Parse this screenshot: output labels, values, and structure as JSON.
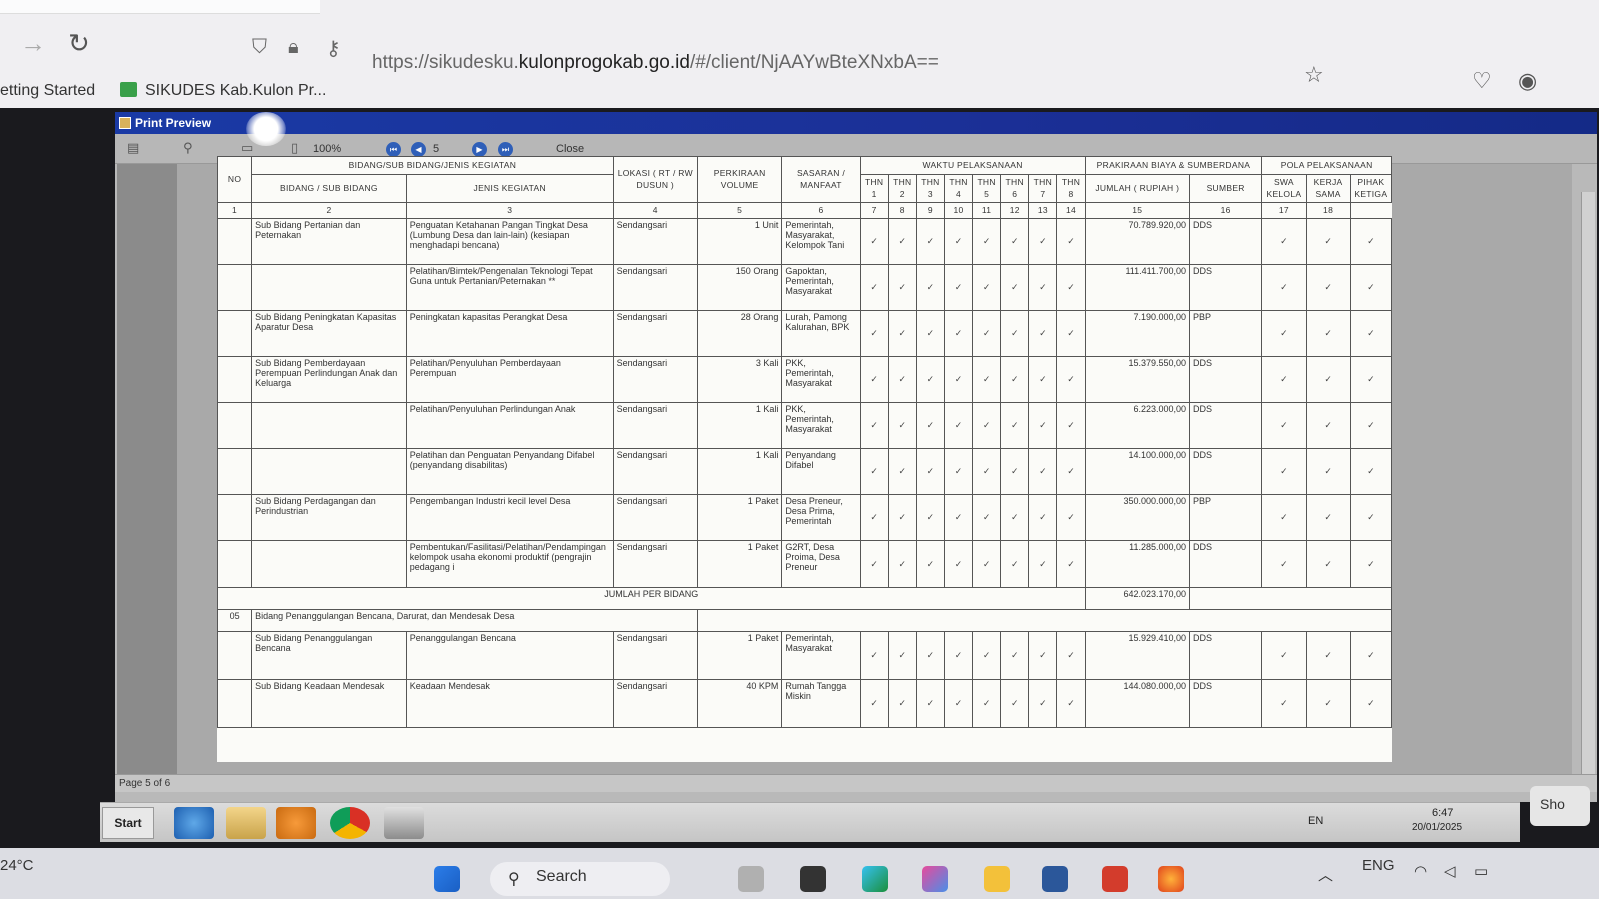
{
  "browser": {
    "url_prefix": "https://sikudesku.",
    "url_domain": "kulonprogokab.go.id",
    "url_suffix": "/#/client/NjAAYwBteXNxbA==",
    "bookmarks": [
      "etting Started",
      "SIKUDES Kab.Kulon Pr..."
    ]
  },
  "print_preview": {
    "title": "Print Preview",
    "zoom": "100%",
    "page_number": "5",
    "close_label": "Close",
    "status": "Page 5 of 6"
  },
  "table": {
    "header": {
      "no": "NO",
      "bidang_group": "BIDANG/SUB BIDANG/JENIS KEGIATAN",
      "bidang_sub": "BIDANG / SUB BIDANG",
      "jenis": "JENIS KEGIATAN",
      "lokasi": "LOKASI ( RT / RW DUSUN )",
      "volume": "PERKIRAAN VOLUME",
      "sasaran": "SASARAN / MANFAAT",
      "waktu": "WAKTU PELAKSANAAN",
      "thn": [
        "THN 1",
        "THN 2",
        "THN 3",
        "THN 4",
        "THN 5",
        "THN 6",
        "THN 7",
        "THN 8"
      ],
      "biaya_group": "PRAKIRAAN BIAYA & SUMBERDANA",
      "jumlah": "JUMLAH ( RUPIAH )",
      "sumber": "SUMBER",
      "pola_group": "POLA PELAKSANAAN",
      "swa": "SWA KELOLA",
      "kerja": "KERJA SAMA",
      "pihak": "PIHAK KETIGA"
    },
    "index_row": [
      "1",
      "2",
      "3",
      "4",
      "5",
      "6",
      "7",
      "8",
      "9",
      "10",
      "11",
      "12",
      "13",
      "14",
      "15",
      "16",
      "17",
      "18"
    ],
    "check": "✓",
    "rows_a": [
      {
        "sub": "Sub Bidang Pertanian dan Peternakan",
        "jenis": "Penguatan Ketahanan Pangan Tingkat Desa (Lumbung Desa dan lain-lain) (kesiapan menghadapi bencana)",
        "lokasi": "Sendangsari",
        "volume": "1 Unit",
        "sasaran": "Pemerintah, Masyarakat, Kelompok Tani",
        "jumlah": "70.789.920,00",
        "sumber": "DDS"
      },
      {
        "sub": "",
        "jenis": "Pelatihan/Bimtek/Pengenalan Teknologi Tepat Guna untuk Pertanian/Peternakan **",
        "lokasi": "Sendangsari",
        "volume": "150 Orang",
        "sasaran": "Gapoktan, Pemerintah, Masyarakat",
        "jumlah": "111.411.700,00",
        "sumber": "DDS"
      },
      {
        "sub": "Sub Bidang Peningkatan Kapasitas Aparatur Desa",
        "jenis": "Peningkatan kapasitas Perangkat Desa",
        "lokasi": "Sendangsari",
        "volume": "28 Orang",
        "sasaran": "Lurah, Pamong Kalurahan, BPK",
        "jumlah": "7.190.000,00",
        "sumber": "PBP"
      },
      {
        "sub": "Sub Bidang Pemberdayaan Perempuan Perlindungan Anak dan Keluarga",
        "jenis": "Pelatihan/Penyuluhan Pemberdayaan Perempuan",
        "lokasi": "Sendangsari",
        "volume": "3 Kali",
        "sasaran": "PKK, Pemerintah, Masyarakat",
        "jumlah": "15.379.550,00",
        "sumber": "DDS"
      },
      {
        "sub": "",
        "jenis": "Pelatihan/Penyuluhan Perlindungan Anak",
        "lokasi": "Sendangsari",
        "volume": "1 Kali",
        "sasaran": "PKK, Pemerintah, Masyarakat",
        "jumlah": "6.223.000,00",
        "sumber": "DDS"
      },
      {
        "sub": "",
        "jenis": "Pelatihan dan Penguatan Penyandang Difabel (penyandang disabilitas)",
        "lokasi": "Sendangsari",
        "volume": "1 Kali",
        "sasaran": "Penyandang Difabel",
        "jumlah": "14.100.000,00",
        "sumber": "DDS"
      },
      {
        "sub": "Sub Bidang Perdagangan dan Perindustrian",
        "jenis": "Pengembangan Industri kecil level Desa",
        "lokasi": "Sendangsari",
        "volume": "1 Paket",
        "sasaran": "Desa Preneur, Desa Prima, Pemerintah",
        "jumlah": "350.000.000,00",
        "sumber": "PBP"
      },
      {
        "sub": "",
        "jenis": "Pembentukan/Fasilitasi/Pelatihan/Pendampingan kelompok usaha ekonomi produktif (pengrajin pedagang i",
        "lokasi": "Sendangsari",
        "volume": "1 Paket",
        "sasaran": "G2RT, Desa Proima, Desa Preneur",
        "jumlah": "11.285.000,00",
        "sumber": "DDS"
      }
    ],
    "subtotal": {
      "label": "JUMLAH PER BIDANG",
      "value": "642.023.170,00"
    },
    "bidang_05": {
      "no": "05",
      "label": "Bidang Penanggulangan Bencana, Darurat, dan Mendesak Desa"
    },
    "rows_b": [
      {
        "sub": "Sub Bidang Penanggulangan Bencana",
        "jenis": "Penanggulangan Bencana",
        "lokasi": "Sendangsari",
        "volume": "1 Paket",
        "sasaran": "Pemerintah, Masyarakat",
        "jumlah": "15.929.410,00",
        "sumber": "DDS"
      },
      {
        "sub": "Sub Bidang Keadaan Mendesak",
        "jenis": "Keadaan Mendesak",
        "lokasi": "Sendangsari",
        "volume": "40 KPM",
        "sasaran": "Rumah Tangga Miskin",
        "jumlah": "144.080.000,00",
        "sumber": "DDS"
      }
    ]
  },
  "remote_taskbar": {
    "start": "Start",
    "lang": "EN",
    "time": "6:47",
    "date": "20/01/2025"
  },
  "host_taskbar": {
    "weather": "24°C",
    "search": "Search",
    "lang": "ENG",
    "show": "Sho"
  }
}
